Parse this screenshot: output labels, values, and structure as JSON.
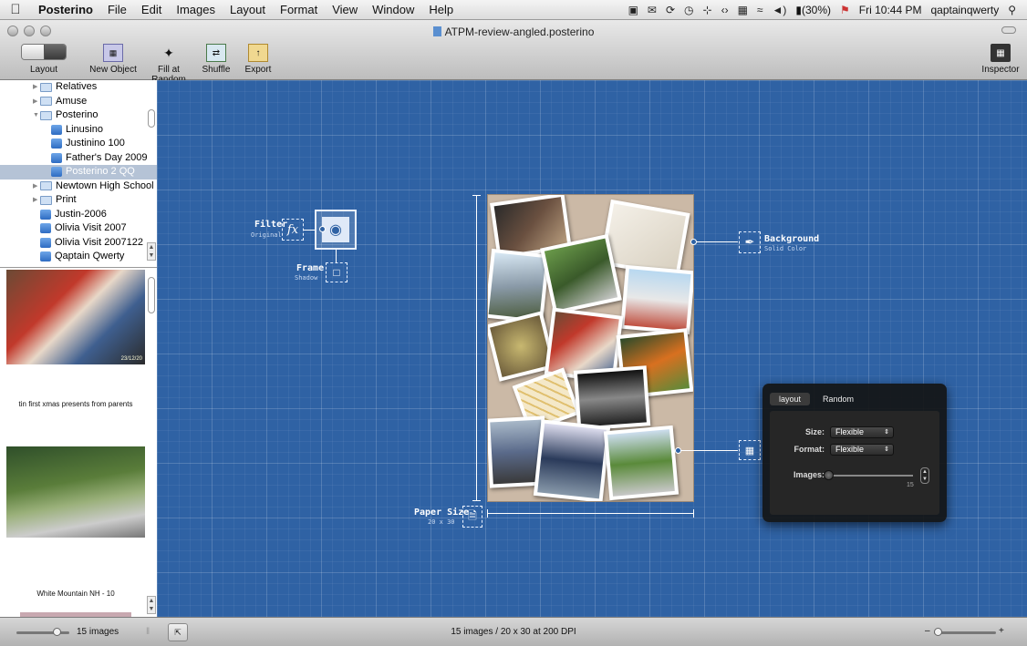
{
  "menubar": {
    "app": "Posterino",
    "items": [
      "File",
      "Edit",
      "Images",
      "Layout",
      "Format",
      "View",
      "Window",
      "Help"
    ],
    "battery": "(30%)",
    "clock": "Fri 10:44 PM",
    "user": "qaptainqwerty"
  },
  "window": {
    "title": "ATPM-review-angled.posterino"
  },
  "toolbar": {
    "layout_label": "Layout",
    "new_object_label": "New Object",
    "fill_random_label": "Fill at Random",
    "shuffle_label": "Shuffle",
    "export_label": "Export",
    "inspector_label": "Inspector"
  },
  "sidebar": {
    "tree": [
      {
        "label": "Relatives",
        "kind": "folder"
      },
      {
        "label": "Amuse",
        "kind": "folder"
      },
      {
        "label": "Posterino",
        "kind": "folder-open"
      },
      {
        "label": "Linusino",
        "kind": "doc"
      },
      {
        "label": "Justinino 100",
        "kind": "doc"
      },
      {
        "label": "Father's Day 2009",
        "kind": "doc"
      },
      {
        "label": "Posterino 2 QQ",
        "kind": "doc",
        "selected": true
      },
      {
        "label": "Newtown High School",
        "kind": "folder"
      },
      {
        "label": "Print",
        "kind": "folder"
      },
      {
        "label": "Justin-2006",
        "kind": "doc"
      },
      {
        "label": "Olivia Visit 2007",
        "kind": "doc"
      },
      {
        "label": "Olivia Visit 2007122",
        "kind": "doc"
      },
      {
        "label": "Qaptain Qwerty",
        "kind": "doc"
      }
    ],
    "photos": {
      "photo1_date": "23/12/20",
      "caption1": "tin first xmas presents from parents",
      "caption2": "White Mountain NH - 10"
    }
  },
  "canvas": {
    "filter_label": "Filter",
    "filter_value": "Original",
    "frame_label": "Frame",
    "frame_value": "Shadow",
    "background_label": "Background",
    "background_value": "Solid Color",
    "paper_label": "Paper Size",
    "paper_value": "20 x 30",
    "fx_glyph": "fx"
  },
  "inspector": {
    "tabs": [
      "layout",
      "Random"
    ],
    "size_label": "Size:",
    "size_value": "Flexible",
    "format_label": "Format:",
    "format_value": "Flexible",
    "images_label": "Images:",
    "images_count": "15"
  },
  "statusbar": {
    "image_count": "15 images",
    "summary": "15 images / 20 x 30 at 200 DPI"
  }
}
